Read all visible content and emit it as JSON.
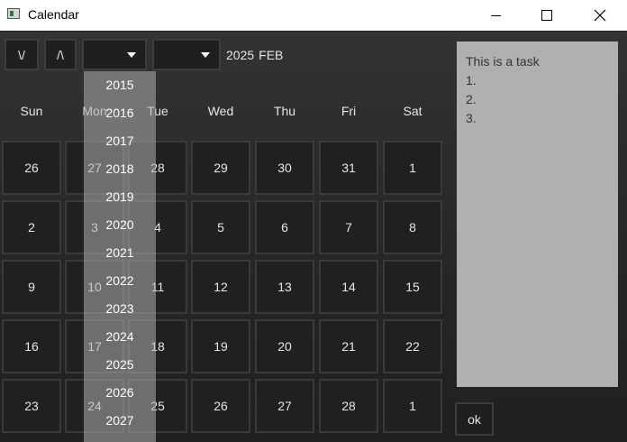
{
  "window": {
    "title": "Calendar",
    "icon": "calendar-app-icon"
  },
  "toolbar": {
    "next_label": "\\/",
    "prev_label": "/\\",
    "year_value": "",
    "month_value": "",
    "current_year": "2025",
    "current_month": "FEB"
  },
  "weekdays": [
    "Sun",
    "Mon",
    "Tue",
    "Wed",
    "Thu",
    "Fri",
    "Sat"
  ],
  "weeks": [
    [
      "26",
      "27",
      "28",
      "29",
      "30",
      "31",
      "1"
    ],
    [
      "2",
      "3",
      "4",
      "5",
      "6",
      "7",
      "8"
    ],
    [
      "9",
      "10",
      "11",
      "12",
      "13",
      "14",
      "15"
    ],
    [
      "16",
      "17",
      "18",
      "19",
      "20",
      "21",
      "22"
    ],
    [
      "23",
      "24",
      "25",
      "26",
      "27",
      "28",
      "1"
    ]
  ],
  "year_dropdown": [
    "2015",
    "2016",
    "2017",
    "2018",
    "2019",
    "2020",
    "2021",
    "2022",
    "2023",
    "2024",
    "2025",
    "2026",
    "2027"
  ],
  "task": {
    "lines": [
      "This is a task",
      "1.",
      "2.",
      "3."
    ],
    "ok_label": "ok"
  },
  "colors": {
    "background": "#222222",
    "cell_border": "#3a3a3a",
    "task_panel": "#b0b0b0",
    "dropdown_overlay": "#afafaf"
  }
}
